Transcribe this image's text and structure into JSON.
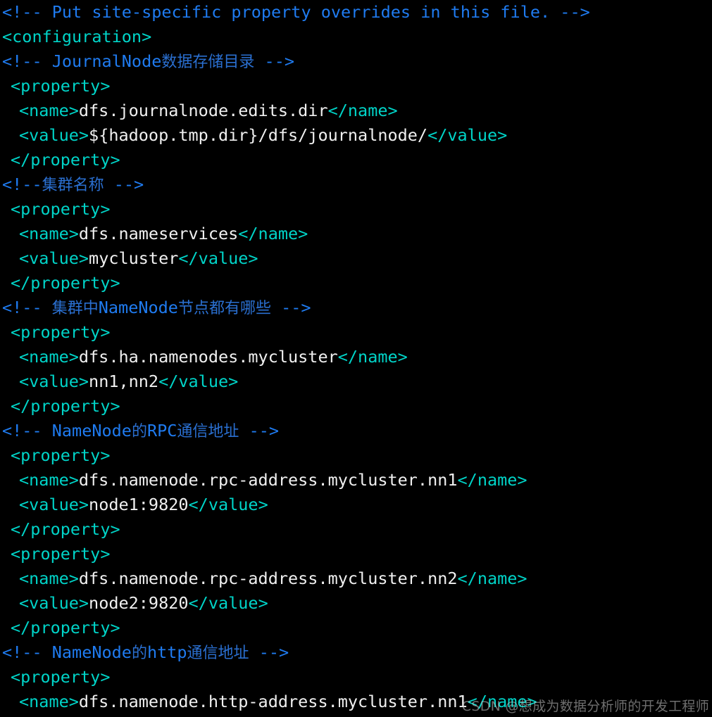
{
  "window": {
    "background_color": "#000000",
    "kind": "terminal-text-editor"
  },
  "theme": {
    "comment_color": "#1f7bf0",
    "comment_cjk_color": "#2a6fd0",
    "tag_color": "#00d4c8",
    "text_color": "#f0f0f0",
    "background_color": "#000000"
  },
  "watermark": {
    "text": "CSDN @想成为数据分析师的开发工程师"
  },
  "code": {
    "language": "xml",
    "file_kind": "hdfs-site.xml",
    "lines": [
      {
        "indent": 0,
        "tokens": [
          {
            "t": "comment",
            "v": "<!-- Put site-specific property overrides in this file. -->"
          }
        ]
      },
      {
        "indent": 0,
        "tokens": [
          {
            "t": "tag",
            "v": "<configuration>"
          }
        ]
      },
      {
        "indent": 0,
        "tokens": [
          {
            "t": "comment",
            "v": "<!-- "
          },
          {
            "t": "comment",
            "v": "JournalNode"
          },
          {
            "t": "cjk",
            "v": "数据存储目录"
          },
          {
            "t": "comment",
            "v": " -->"
          }
        ]
      },
      {
        "indent": 1,
        "tokens": [
          {
            "t": "tag",
            "v": "<property>"
          }
        ]
      },
      {
        "indent": 2,
        "tokens": [
          {
            "t": "tag",
            "v": "<name>"
          },
          {
            "t": "text",
            "v": "dfs.journalnode.edits.dir"
          },
          {
            "t": "tag",
            "v": "</name>"
          }
        ]
      },
      {
        "indent": 2,
        "tokens": [
          {
            "t": "tag",
            "v": "<value>"
          },
          {
            "t": "text",
            "v": "${hadoop.tmp.dir}/dfs/journalnode/"
          },
          {
            "t": "tag",
            "v": "</value>"
          }
        ]
      },
      {
        "indent": 1,
        "tokens": [
          {
            "t": "tag",
            "v": "</property>"
          }
        ]
      },
      {
        "indent": 0,
        "tokens": [
          {
            "t": "comment",
            "v": "<!--"
          },
          {
            "t": "cjk",
            "v": "集群名称"
          },
          {
            "t": "comment",
            "v": " -->"
          }
        ]
      },
      {
        "indent": 1,
        "tokens": [
          {
            "t": "tag",
            "v": "<property>"
          }
        ]
      },
      {
        "indent": 2,
        "tokens": [
          {
            "t": "tag",
            "v": "<name>"
          },
          {
            "t": "text",
            "v": "dfs.nameservices"
          },
          {
            "t": "tag",
            "v": "</name>"
          }
        ]
      },
      {
        "indent": 2,
        "tokens": [
          {
            "t": "tag",
            "v": "<value>"
          },
          {
            "t": "text",
            "v": "mycluster"
          },
          {
            "t": "tag",
            "v": "</value>"
          }
        ]
      },
      {
        "indent": 1,
        "tokens": [
          {
            "t": "tag",
            "v": "</property>"
          }
        ]
      },
      {
        "indent": 0,
        "tokens": [
          {
            "t": "comment",
            "v": "<!-- "
          },
          {
            "t": "cjk",
            "v": "集群中"
          },
          {
            "t": "comment",
            "v": "NameNode"
          },
          {
            "t": "cjk",
            "v": "节点都有哪些"
          },
          {
            "t": "comment",
            "v": " -->"
          }
        ]
      },
      {
        "indent": 1,
        "tokens": [
          {
            "t": "tag",
            "v": "<property>"
          }
        ]
      },
      {
        "indent": 2,
        "tokens": [
          {
            "t": "tag",
            "v": "<name>"
          },
          {
            "t": "text",
            "v": "dfs.ha.namenodes.mycluster"
          },
          {
            "t": "tag",
            "v": "</name>"
          }
        ]
      },
      {
        "indent": 2,
        "tokens": [
          {
            "t": "tag",
            "v": "<value>"
          },
          {
            "t": "text",
            "v": "nn1,nn2"
          },
          {
            "t": "tag",
            "v": "</value>"
          }
        ]
      },
      {
        "indent": 1,
        "tokens": [
          {
            "t": "tag",
            "v": "</property>"
          }
        ]
      },
      {
        "indent": 0,
        "tokens": [
          {
            "t": "comment",
            "v": "<!-- "
          },
          {
            "t": "comment",
            "v": "NameNode"
          },
          {
            "t": "cjk",
            "v": "的"
          },
          {
            "t": "comment",
            "v": "RPC"
          },
          {
            "t": "cjk",
            "v": "通信地址"
          },
          {
            "t": "comment",
            "v": " -->"
          }
        ]
      },
      {
        "indent": 1,
        "tokens": [
          {
            "t": "tag",
            "v": "<property>"
          }
        ]
      },
      {
        "indent": 2,
        "tokens": [
          {
            "t": "tag",
            "v": "<name>"
          },
          {
            "t": "text",
            "v": "dfs.namenode.rpc-address.mycluster.nn1"
          },
          {
            "t": "tag",
            "v": "</name>"
          }
        ]
      },
      {
        "indent": 2,
        "tokens": [
          {
            "t": "tag",
            "v": "<value>"
          },
          {
            "t": "text",
            "v": "node1:9820"
          },
          {
            "t": "tag",
            "v": "</value>"
          }
        ]
      },
      {
        "indent": 1,
        "tokens": [
          {
            "t": "tag",
            "v": "</property>"
          }
        ]
      },
      {
        "indent": 1,
        "tokens": [
          {
            "t": "tag",
            "v": "<property>"
          }
        ]
      },
      {
        "indent": 2,
        "tokens": [
          {
            "t": "tag",
            "v": "<name>"
          },
          {
            "t": "text",
            "v": "dfs.namenode.rpc-address.mycluster.nn2"
          },
          {
            "t": "tag",
            "v": "</name>"
          }
        ]
      },
      {
        "indent": 2,
        "tokens": [
          {
            "t": "tag",
            "v": "<value>"
          },
          {
            "t": "text",
            "v": "node2:9820"
          },
          {
            "t": "tag",
            "v": "</value>"
          }
        ]
      },
      {
        "indent": 1,
        "tokens": [
          {
            "t": "tag",
            "v": "</property>"
          }
        ]
      },
      {
        "indent": 0,
        "tokens": [
          {
            "t": "comment",
            "v": "<!-- "
          },
          {
            "t": "comment",
            "v": "NameNode"
          },
          {
            "t": "cjk",
            "v": "的"
          },
          {
            "t": "comment",
            "v": "http"
          },
          {
            "t": "cjk",
            "v": "通信地址"
          },
          {
            "t": "comment",
            "v": " -->"
          }
        ]
      },
      {
        "indent": 1,
        "tokens": [
          {
            "t": "tag",
            "v": "<property>"
          }
        ]
      },
      {
        "indent": 2,
        "tokens": [
          {
            "t": "tag",
            "v": "<name>"
          },
          {
            "t": "text",
            "v": "dfs.namenode.http-address.mycluster.nn1"
          },
          {
            "t": "tag",
            "v": "</name>"
          }
        ]
      }
    ]
  }
}
